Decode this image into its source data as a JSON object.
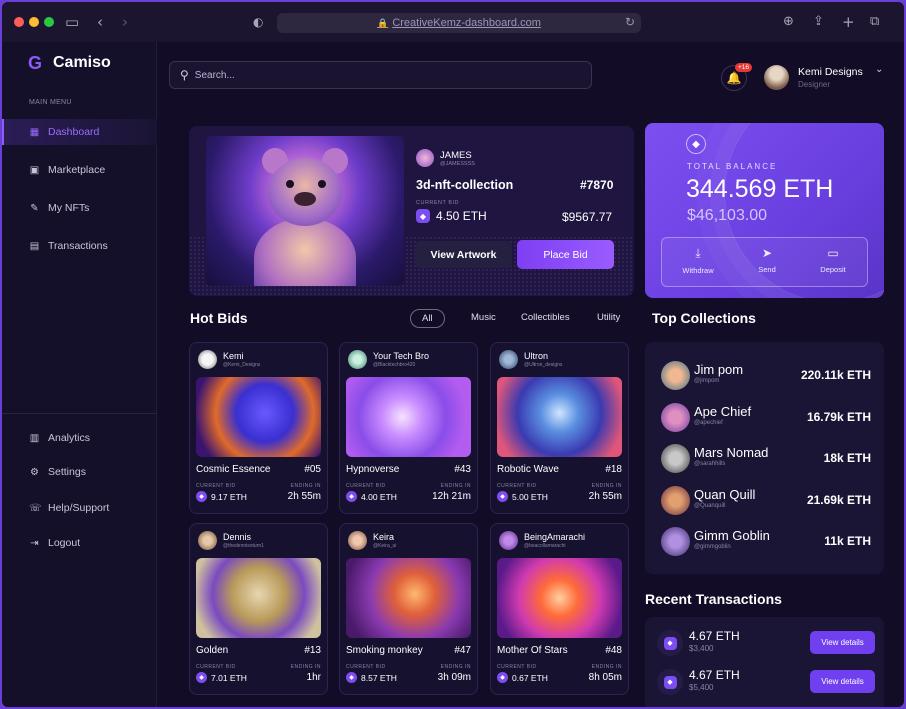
{
  "browser": {
    "url": "CreativeKemz-dashboard.com"
  },
  "brand": {
    "name": "Camiso",
    "accent": "#8b5cf6"
  },
  "sidebar": {
    "section_label": "MAIN MENU",
    "items": [
      {
        "label": "Dashboard",
        "icon": "grid-icon"
      },
      {
        "label": "Marketplace",
        "icon": "shop-icon"
      },
      {
        "label": "My NFTs",
        "icon": "brush-icon"
      },
      {
        "label": "Transactions",
        "icon": "document-icon"
      }
    ],
    "bottom_items": [
      {
        "label": "Analytics",
        "icon": "chart-icon"
      },
      {
        "label": "Settings",
        "icon": "gear-icon"
      },
      {
        "label": "Help/Support",
        "icon": "phone-icon"
      },
      {
        "label": "Logout",
        "icon": "logout-icon"
      }
    ]
  },
  "header": {
    "search_placeholder": "Search...",
    "notification_count": "+16",
    "user_name": "Kemi Designs",
    "user_role": "Designer"
  },
  "featured": {
    "owner_name": "JAMES",
    "owner_handle": "@JAMESSSS",
    "title": "3d-nft-collection",
    "number": "#7870",
    "bid_label": "CURRENT BID",
    "eth": "4.50 ETH",
    "usd": "$9567.77",
    "view_label": "View Artwork",
    "bid_button": "Place Bid"
  },
  "balance": {
    "label": "TOTAL BALANCE",
    "eth": "344.569 ETH",
    "usd": "$46,103.00",
    "actions": [
      "Withdraw",
      "Send",
      "Deposit"
    ]
  },
  "hot_bids": {
    "title": "Hot Bids",
    "filters": [
      "All",
      "Music",
      "Collectibles",
      "Utility"
    ],
    "bid_label": "CURRENT BID",
    "ending_label": "ENDING IN",
    "cards": [
      {
        "creator": "Kemi",
        "handle": "@Kemi_Designs",
        "title": "Cosmic Essence",
        "number": "#05",
        "eth": "9.17 ETH",
        "ending": "2h 55m"
      },
      {
        "creator": "Your Tech Bro",
        "handle": "@Blacktechbro420",
        "title": "Hypnoverse",
        "number": "#43",
        "eth": "4.00 ETH",
        "ending": "12h 21m"
      },
      {
        "creator": "Ultron",
        "handle": "@Ultron_designs",
        "title": "Robotic Wave",
        "number": "#18",
        "eth": "5.00 ETH",
        "ending": "2h 55m"
      },
      {
        "creator": "Dennis",
        "handle": "@thedennisoturn1",
        "title": "Golden",
        "number": "#13",
        "eth": "7.01 ETH",
        "ending": "1hr"
      },
      {
        "creator": "Keira",
        "handle": "@Keira_ui",
        "title": "Smoking monkey",
        "number": "#47",
        "eth": "8.57 ETH",
        "ending": "3h 09m"
      },
      {
        "creator": "BeingAmarachi",
        "handle": "@beacollamarachi",
        "title": "Mother Of Stars",
        "number": "#48",
        "eth": "0.67 ETH",
        "ending": "8h 05m"
      }
    ]
  },
  "top_collections": {
    "title": "Top Collections",
    "items": [
      {
        "name": "Jim pom",
        "handle": "@jimpom",
        "value": "220.11k ETH"
      },
      {
        "name": "Ape Chief",
        "handle": "@apechief",
        "value": "16.79k ETH"
      },
      {
        "name": "Mars Nomad",
        "handle": "@sarahhills",
        "value": "18k ETH"
      },
      {
        "name": "Quan Quill",
        "handle": "@Quanquill",
        "value": "21.69k ETH"
      },
      {
        "name": "Gimm Goblin",
        "handle": "@gimmgoblin",
        "value": "11k ETH"
      }
    ]
  },
  "recent_transactions": {
    "title": "Recent Transactions",
    "button_label": "View details",
    "items": [
      {
        "eth": "4.67 ETH",
        "usd": "$3,400"
      },
      {
        "eth": "4.67 ETH",
        "usd": "$5,400"
      }
    ]
  }
}
